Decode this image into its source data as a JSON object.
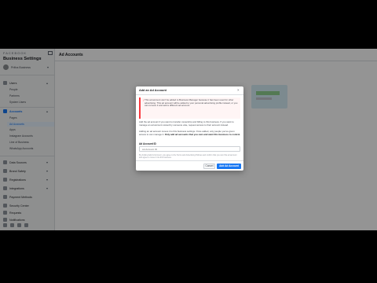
{
  "sidebar": {
    "brand": "FACEBOOK",
    "title": "Business Settings",
    "business_name": "Pritha Business",
    "groups": [
      {
        "label": "Users",
        "subitems": [
          "People",
          "Partners",
          "System Users"
        ]
      },
      {
        "label": "Accounts",
        "subitems": [
          "Pages",
          "Ad Accounts",
          "Apps",
          "Instagram Accounts",
          "Line of Business",
          "WhatsApp Accounts"
        ]
      },
      {
        "label": "Data Sources"
      },
      {
        "label": "Brand Safety"
      },
      {
        "label": "Registrations"
      },
      {
        "label": "Integrations"
      },
      {
        "label": "Payment Methods"
      },
      {
        "label": "Security Center"
      },
      {
        "label": "Requests"
      },
      {
        "label": "Notifications"
      }
    ]
  },
  "main": {
    "title": "Ad Accounts"
  },
  "dialog": {
    "title": "Add an Ad Account",
    "warning_text": "This ad account can't be added to Business Manager because it has been used for other advertising. This ad account will be added to your personal advertising profile instead, or you can remove it and add a different ad account.",
    "para1": "Add the ad account if you want to transfer ownership and billing to this business. If you want to manage an ad account owned by someone else, request access to their account instead.",
    "para2_prefix": "Adding an ad account moves it to this business settings. Once added, only people you've given access to can manage it. ",
    "para2_bold": "Only add ad accounts that you own and want this business to control.",
    "field_label": "Ad Account ID",
    "field_placeholder": "Ad Account ID",
    "fine_print": "By clicking Add Ad Account, you agree to the Terms and Advertising Policies and confirm that you own this ad account and agree to move it into this business.",
    "cancel_label": "Cancel",
    "add_label": "Add Ad Account"
  },
  "colors": {
    "accent": "#1877f2",
    "warning": "#fa383e",
    "cursor_highlight": "#f0e030"
  }
}
